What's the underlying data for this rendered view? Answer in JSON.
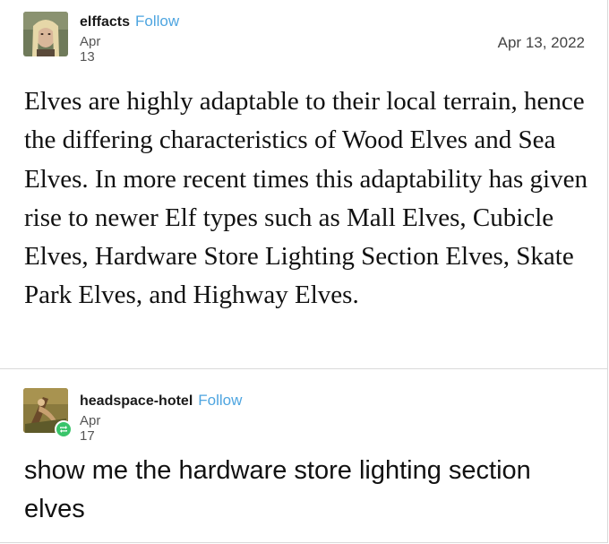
{
  "posts": [
    {
      "username": "elffacts",
      "follow_label": "Follow",
      "date_short": "Apr 13",
      "date_full": "Apr 13, 2022",
      "body": "Elves are highly adaptable to their local terrain, hence the differing characteristics of Wood Elves and Sea Elves. In more recent times this adaptability has given rise to newer Elf types such as Mall Elves, Cubicle Elves, Hardware Store Lighting Section Elves, Skate Park Elves, and Highway Elves."
    },
    {
      "username": "headspace-hotel",
      "follow_label": "Follow",
      "date_short": "Apr 17",
      "body": "show me the hardware store lighting section elves"
    }
  ],
  "icons": {
    "reblog": "reblog-icon"
  },
  "colors": {
    "follow": "#4ea5e0",
    "reblog_badge": "#39c46a"
  }
}
